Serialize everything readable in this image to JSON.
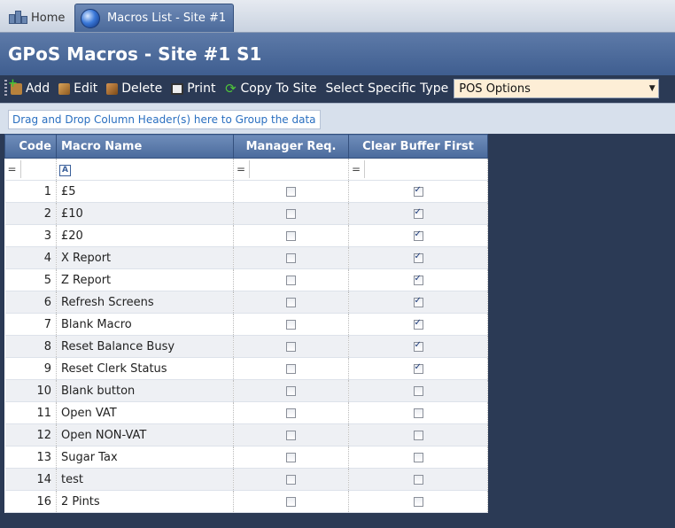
{
  "tabs": {
    "home": "Home",
    "active": "Macros List - Site #1"
  },
  "title": "GPoS Macros - Site #1 S1",
  "toolbar": {
    "add": "Add",
    "edit": "Edit",
    "delete": "Delete",
    "print": "Print",
    "copy": "Copy To Site",
    "select_label": "Select Specific Type",
    "select_value": "POS Options"
  },
  "group_panel": "Drag and Drop Column Header(s) here to Group the data",
  "columns": {
    "code": "Code",
    "name": "Macro Name",
    "manager": "Manager Req.",
    "clear": "Clear Buffer First"
  },
  "filter": {
    "eq": "=",
    "name_icon": "A"
  },
  "rows": [
    {
      "code": "1",
      "name": "£5",
      "manager": false,
      "clear": true
    },
    {
      "code": "2",
      "name": "£10",
      "manager": false,
      "clear": true
    },
    {
      "code": "3",
      "name": "£20",
      "manager": false,
      "clear": true
    },
    {
      "code": "4",
      "name": "X Report",
      "manager": false,
      "clear": true
    },
    {
      "code": "5",
      "name": "Z Report",
      "manager": false,
      "clear": true
    },
    {
      "code": "6",
      "name": "Refresh Screens",
      "manager": false,
      "clear": true
    },
    {
      "code": "7",
      "name": "Blank Macro",
      "manager": false,
      "clear": true
    },
    {
      "code": "8",
      "name": "Reset Balance Busy",
      "manager": false,
      "clear": true
    },
    {
      "code": "9",
      "name": "Reset Clerk Status",
      "manager": false,
      "clear": true
    },
    {
      "code": "10",
      "name": "Blank button",
      "manager": false,
      "clear": false
    },
    {
      "code": "11",
      "name": "Open VAT",
      "manager": false,
      "clear": false
    },
    {
      "code": "12",
      "name": "Open NON-VAT",
      "manager": false,
      "clear": false
    },
    {
      "code": "13",
      "name": "Sugar Tax",
      "manager": false,
      "clear": false
    },
    {
      "code": "14",
      "name": "test",
      "manager": false,
      "clear": false
    },
    {
      "code": "16",
      "name": "2 Pints",
      "manager": false,
      "clear": false
    }
  ]
}
